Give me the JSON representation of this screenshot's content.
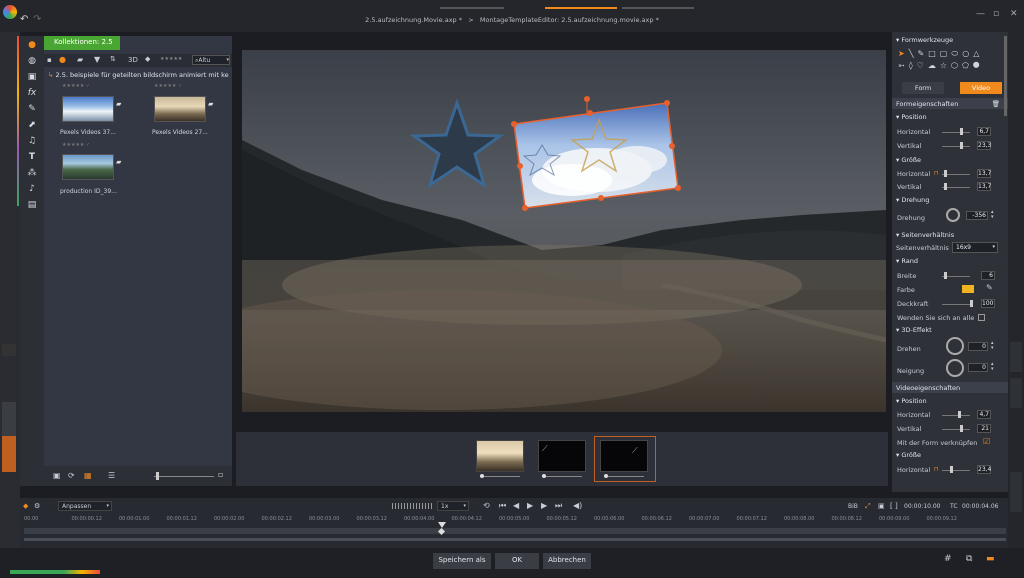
{
  "titlebar": {
    "path_left": "2.5.aufzeichnung.Movie.axp *",
    "separator": ">",
    "path_right": "MontageTemplateEditor: 2.5.aufzeichnung.movie.axp *"
  },
  "library": {
    "tab_label": "Kollektionen: 2.5",
    "view_3d": "3D",
    "sort_label": "Altu",
    "folder_path": "2.5. beispiele für geteilten bildschirm animiert mit ke",
    "items": [
      {
        "label": "Pexels Videos 37..."
      },
      {
        "label": "Pexels Videos 27..."
      },
      {
        "label": "production ID_39..."
      }
    ]
  },
  "timeline": {
    "fit_label": "Anpassen",
    "speed": "1x",
    "bib": "BiB",
    "tc_label": "TC",
    "tc_start": "00:00:10.00",
    "tc_end": "00:00:04.06",
    "ticks": [
      "00.00",
      "00:00:00.12",
      "00:00:01.00",
      "00:00:01.12",
      "00:00:02.00",
      "00:00:02.12",
      "00:00:03.00",
      "00:00:03.12",
      "00:00:04.00",
      "00:00:04.12",
      "00:00:05.00",
      "00:00:05.12",
      "00:00:06.00",
      "00:00:06.12",
      "00:00:07.00",
      "00:00:07.12",
      "00:00:08.00",
      "00:00:08.12",
      "00:00:09.00",
      "00:00:09.12"
    ]
  },
  "footer": {
    "save_as": "Speichern als",
    "ok": "OK",
    "cancel": "Abbrechen"
  },
  "right_panel": {
    "shape_tools_title": "Formwerkzeuge",
    "tab_form": "Form",
    "tab_video": "Video",
    "shape_props_title": "Formeigenschaften",
    "position": "Position",
    "horizontal": "Horizontal",
    "vertical": "Vertikal",
    "pos_h": "6,7",
    "pos_v": "23,3",
    "size": "Größe",
    "size_h": "13,7",
    "size_v": "13,7",
    "rotation_section": "Drehung",
    "rotation_label": "Drehung",
    "rotation_value": "-356",
    "aspect_section": "Seitenverhältnis",
    "aspect_label": "Seitenverhältnis",
    "aspect_value": "16x9",
    "border_section": "Rand",
    "width_label": "Breite",
    "width_value": "6",
    "color_label": "Farbe",
    "opacity_label": "Deckkraft",
    "opacity_value": "100",
    "apply_all": "Wenden Sie sich an alle",
    "effect3d_section": "3D-Effekt",
    "rotate_label": "Drehen",
    "rotate_value": "0",
    "tilt_label": "Neigung",
    "tilt_value": "0",
    "video_props_title": "Videoeigenschaften",
    "video_position": "Position",
    "video_h": "4,7",
    "video_v": "21",
    "link_shape": "Mit der Form verknüpfen",
    "video_size": "Größe",
    "video_size_h": "23,4"
  },
  "colors": {
    "accent_orange": "#f08a1c",
    "green_tab": "#4aa632",
    "border_orange": "#e8602c",
    "star_blue": "#3a6a9a"
  }
}
